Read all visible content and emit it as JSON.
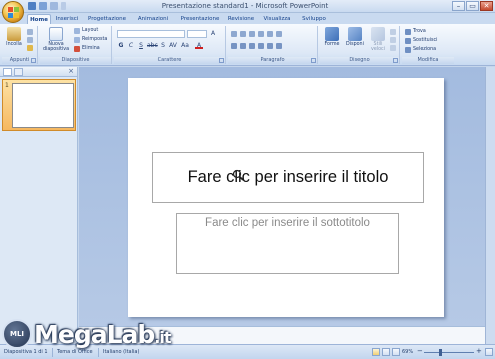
{
  "window": {
    "title": "Presentazione standard1 - Microsoft PowerPoint",
    "minimize": "–",
    "maximize": "▭",
    "close": "✕"
  },
  "tabs": [
    "Home",
    "Inserisci",
    "Progettazione",
    "Animazioni",
    "Presentazione",
    "Revisione",
    "Visualizza",
    "Sviluppo"
  ],
  "active_tab": "Home",
  "ribbon": {
    "groups": {
      "appunti": "Appunti",
      "diapositive": "Diapositive",
      "carattere": "Carattere",
      "paragrafo": "Paragrafo",
      "disegno": "Disegno",
      "modifica": "Modifica"
    },
    "incolla": "Incolla",
    "nuova_diapositiva": "Nuova diapositiva",
    "layout": "Layout",
    "reimposta": "Reimposta",
    "elimina": "Elimina",
    "forme": "Forme",
    "disponi": "Disponi",
    "stili_veloci": "Stili veloci",
    "trova": "Trova",
    "sostituisci": "Sostituisci",
    "seleziona": "Seleziona",
    "bold": "G",
    "italic": "C",
    "underline": "S"
  },
  "slide_panel": {
    "slide_number": "1"
  },
  "slide": {
    "title_placeholder": "Fare clic per inserire il titolo",
    "subtitle_placeholder": "Fare clic per inserire il sottotitolo"
  },
  "status_bar": {
    "slide_info": "Diapositiva 1 di 1",
    "theme": "Tema di Office",
    "language": "Italiano (Italia)",
    "zoom": "69%",
    "zoom_level": 0.69
  },
  "watermark": {
    "badge": "MLI",
    "text_main": "MegaLab",
    "text_suffix": ".it"
  },
  "colors": {
    "accent": "#15428b",
    "ribbon_bg": "#dde8f6",
    "workspace": "#a3bbdf",
    "selected_thumb": "#f6b860"
  }
}
